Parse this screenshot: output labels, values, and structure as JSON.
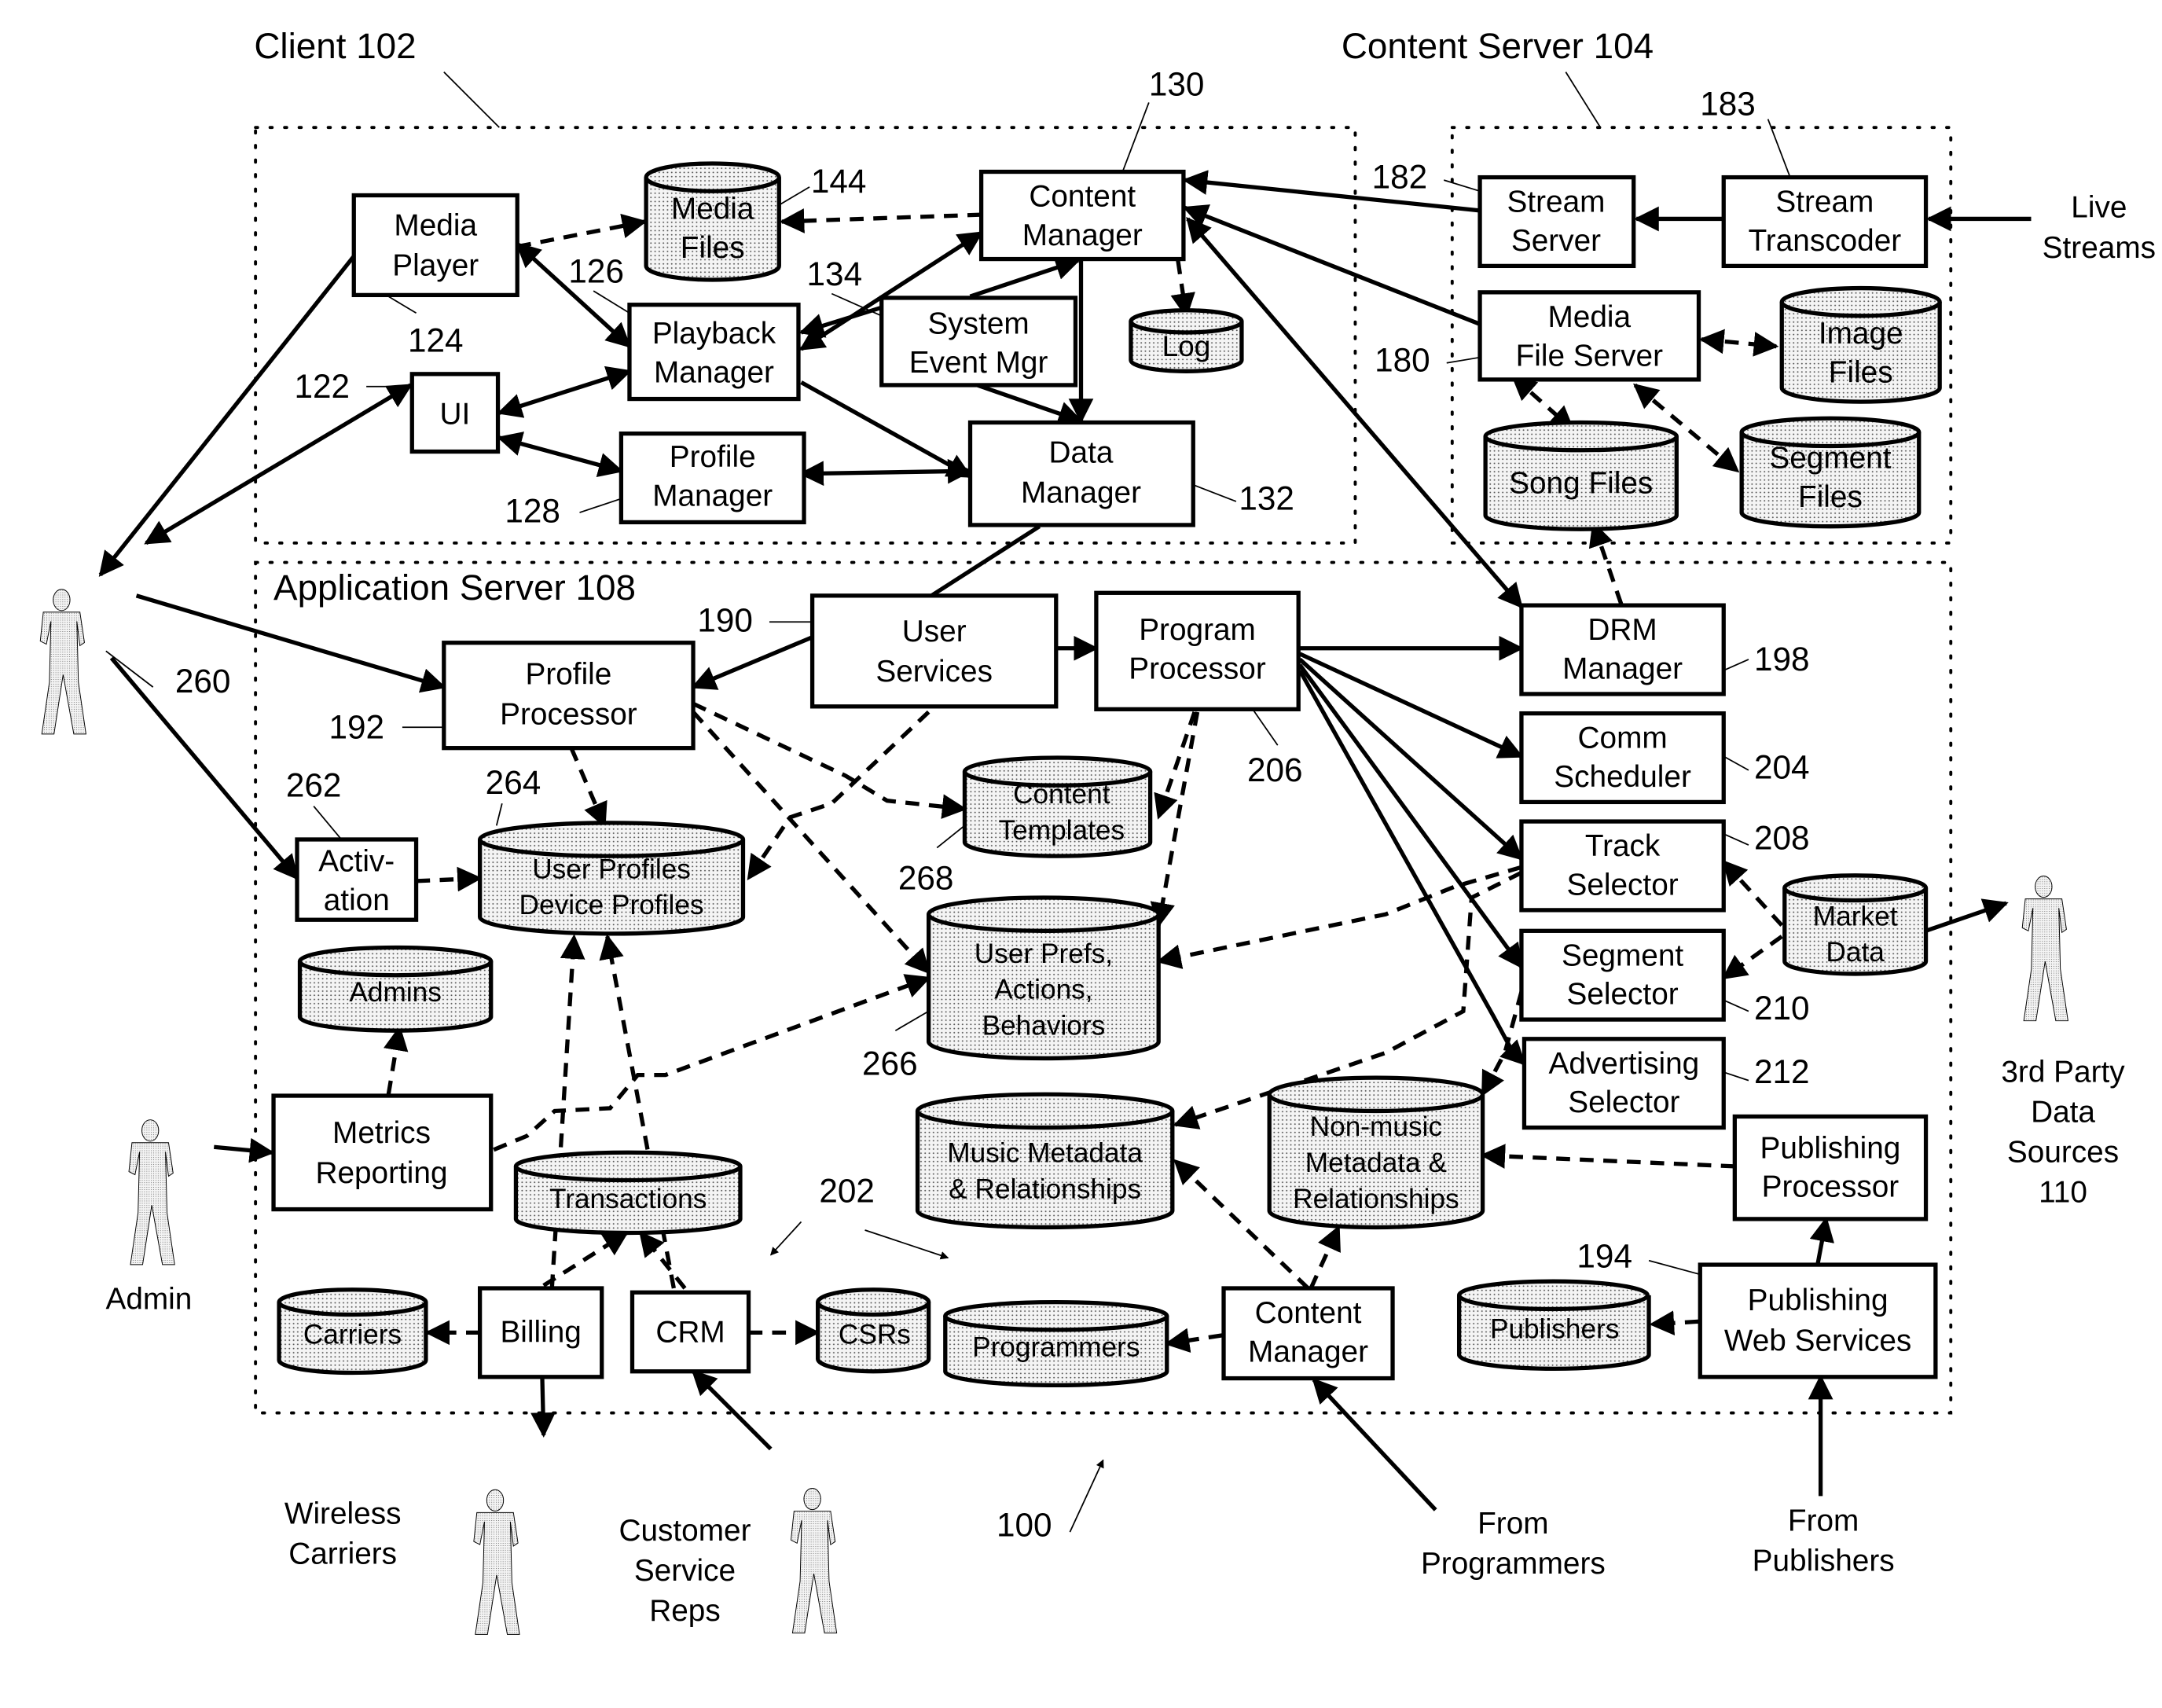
{
  "figure_number": "100",
  "regions": {
    "client": "Client 102",
    "content_server": "Content Server 104",
    "application_server": "Application Server 108"
  },
  "client": {
    "media_player": [
      "Media",
      "Player"
    ],
    "media_player_ref": "124",
    "ui": "UI",
    "ui_ref": "122",
    "playback_manager": [
      "Playback",
      "Manager"
    ],
    "playback_manager_ref": "126",
    "profile_manager": [
      "Profile",
      "Manager"
    ],
    "profile_manager_ref": "128",
    "media_files": [
      "Media",
      "Files"
    ],
    "media_files_ref": "144",
    "content_manager": [
      "Content",
      "Manager"
    ],
    "content_manager_ref": "130",
    "system_event_mgr": [
      "System",
      "Event Mgr"
    ],
    "system_event_mgr_ref": "134",
    "log": "Log",
    "data_manager": [
      "Data",
      "Manager"
    ],
    "data_manager_ref": "132"
  },
  "content_server": {
    "stream_server": [
      "Stream",
      "Server"
    ],
    "stream_server_ref": "182",
    "stream_transcoder": [
      "Stream",
      "Transcoder"
    ],
    "stream_transcoder_ref": "183",
    "media_file_server": [
      "Media",
      "File Server"
    ],
    "media_file_server_ref": "180",
    "image_files": [
      "Image",
      "Files"
    ],
    "song_files": "Song Files",
    "segment_files": [
      "Segment",
      "Files"
    ]
  },
  "app_server": {
    "user_services": [
      "User",
      "Services"
    ],
    "user_services_ref": "190",
    "program_processor": [
      "Program",
      "Processor"
    ],
    "program_processor_ref": "206",
    "profile_processor": [
      "Profile",
      "Processor"
    ],
    "profile_processor_ref": "192",
    "drm_manager": [
      "DRM",
      "Manager"
    ],
    "drm_manager_ref": "198",
    "comm_scheduler": [
      "Comm",
      "Scheduler"
    ],
    "comm_scheduler_ref": "204",
    "track_selector": [
      "Track",
      "Selector"
    ],
    "track_selector_ref": "208",
    "segment_selector": [
      "Segment",
      "Selector"
    ],
    "segment_selector_ref": "210",
    "advertising_selector": [
      "Advertising",
      "Selector"
    ],
    "advertising_selector_ref": "212",
    "activation": [
      "Activ-",
      "ation"
    ],
    "activation_ref": "262",
    "user_profiles": [
      "User  Profiles",
      "Device Profiles"
    ],
    "user_profiles_ref": "264",
    "content_templates": [
      "Content",
      "Templates"
    ],
    "content_templates_ref": "268",
    "user_prefs": [
      "User Prefs,",
      "Actions,",
      "Behaviors"
    ],
    "user_prefs_ref": "266",
    "market_data": [
      "Market",
      "Data"
    ],
    "admins": "Admins",
    "metrics_reporting": [
      "Metrics",
      "Reporting"
    ],
    "transactions": "Transactions",
    "music_metadata": [
      "Music Metadata",
      "& Relationships"
    ],
    "nonmusic_metadata": [
      "Non-music",
      "Metadata &",
      "Relationships"
    ],
    "publishing_processor": [
      "Publishing",
      "Processor"
    ],
    "carriers": "Carriers",
    "billing": "Billing",
    "crm": "CRM",
    "csrs": "CSRs",
    "programmers": "Programmers",
    "content_manager2": [
      "Content",
      "Manager"
    ],
    "publishers": "Publishers",
    "publishing_web_services": [
      "Publishing",
      "Web Services"
    ],
    "publishing_web_services_ref": "194",
    "group_ref": "202"
  },
  "actors": {
    "user_ref": "260",
    "admin": "Admin",
    "wireless_carriers": [
      "Wireless",
      "Carriers"
    ],
    "customer_service_reps": [
      "Customer",
      "Service",
      "Reps"
    ],
    "third_party": [
      "3rd Party",
      "Data",
      "Sources",
      "110"
    ]
  },
  "external": {
    "live_streams": [
      "Live",
      "Streams"
    ],
    "from_programmers": [
      "From",
      "Programmers"
    ],
    "from_publishers": [
      "From",
      "Publishers"
    ]
  }
}
